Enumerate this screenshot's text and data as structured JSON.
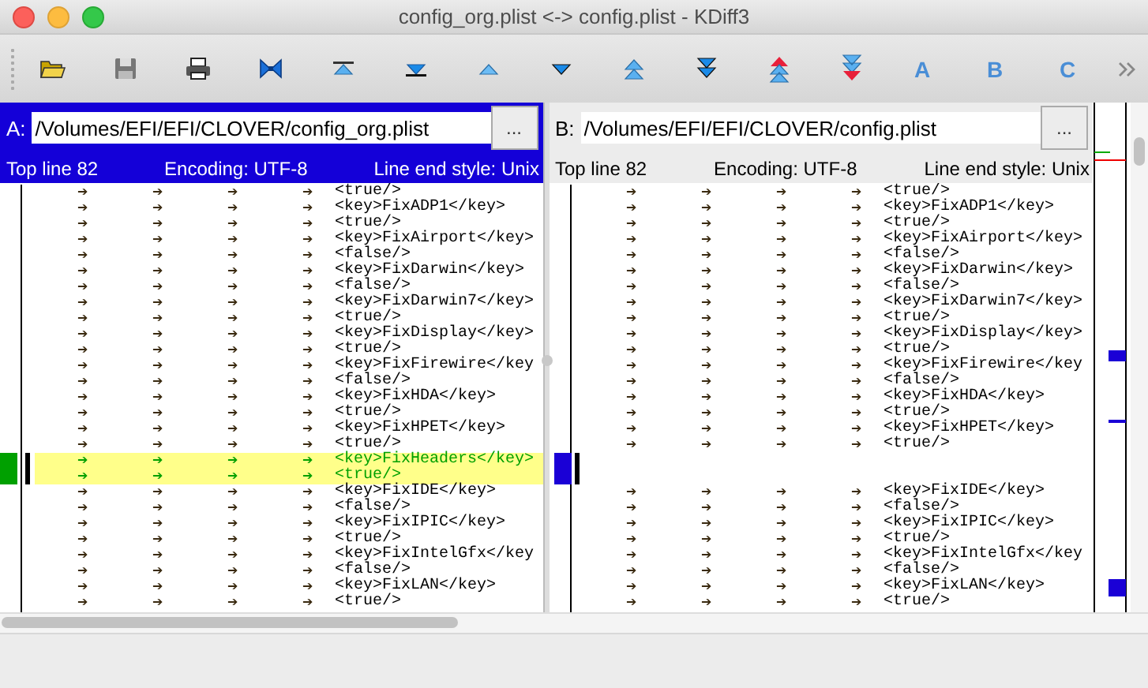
{
  "window": {
    "title": "config_org.plist <-> config.plist - KDiff3"
  },
  "toolbar": {
    "letter_buttons": [
      "A",
      "B",
      "C"
    ]
  },
  "panes": [
    {
      "label": "A:",
      "path": "/Volumes/EFI/EFI/CLOVER/config_org.plist",
      "browse_button": "...",
      "selected": true,
      "top_line": "Top line 82",
      "encoding": "Encoding: UTF-8",
      "line_end": "Line end style: Unix",
      "lines": [
        {
          "kind": "normal",
          "tab_marks": [
            "➔",
            "➔",
            "➔",
            "➔"
          ],
          "text": "<true/>"
        },
        {
          "kind": "normal",
          "tab_marks": [
            "➔",
            "➔",
            "➔",
            "➔"
          ],
          "text": "<key>FixADP1</key>"
        },
        {
          "kind": "normal",
          "tab_marks": [
            "➔",
            "➔",
            "➔",
            "➔"
          ],
          "text": "<true/>"
        },
        {
          "kind": "normal",
          "tab_marks": [
            "➔",
            "➔",
            "➔",
            "➔"
          ],
          "text": "<key>FixAirport</key>"
        },
        {
          "kind": "normal",
          "tab_marks": [
            "➔",
            "➔",
            "➔",
            "➔"
          ],
          "text": "<false/>"
        },
        {
          "kind": "normal",
          "tab_marks": [
            "➔",
            "➔",
            "➔",
            "➔"
          ],
          "text": "<key>FixDarwin</key>"
        },
        {
          "kind": "normal",
          "tab_marks": [
            "➔",
            "➔",
            "➔",
            "➔"
          ],
          "text": "<false/>"
        },
        {
          "kind": "normal",
          "tab_marks": [
            "➔",
            "➔",
            "➔",
            "➔"
          ],
          "text": "<key>FixDarwin7</key>"
        },
        {
          "kind": "normal",
          "tab_marks": [
            "➔",
            "➔",
            "➔",
            "➔"
          ],
          "text": "<true/>"
        },
        {
          "kind": "normal",
          "tab_marks": [
            "➔",
            "➔",
            "➔",
            "➔"
          ],
          "text": "<key>FixDisplay</key>"
        },
        {
          "kind": "normal",
          "tab_marks": [
            "➔",
            "➔",
            "➔",
            "➔"
          ],
          "text": "<true/>"
        },
        {
          "kind": "normal",
          "tab_marks": [
            "➔",
            "➔",
            "➔",
            "➔"
          ],
          "text": "<key>FixFirewire</key"
        },
        {
          "kind": "normal",
          "tab_marks": [
            "➔",
            "➔",
            "➔",
            "➔"
          ],
          "text": "<false/>"
        },
        {
          "kind": "normal",
          "tab_marks": [
            "➔",
            "➔",
            "➔",
            "➔"
          ],
          "text": "<key>FixHDA</key>"
        },
        {
          "kind": "normal",
          "tab_marks": [
            "➔",
            "➔",
            "➔",
            "➔"
          ],
          "text": "<true/>"
        },
        {
          "kind": "normal",
          "tab_marks": [
            "➔",
            "➔",
            "➔",
            "➔"
          ],
          "text": "<key>FixHPET</key>"
        },
        {
          "kind": "normal",
          "tab_marks": [
            "➔",
            "➔",
            "➔",
            "➔"
          ],
          "text": "<true/>"
        },
        {
          "kind": "changed",
          "tab_marks": [
            "➔",
            "➔",
            "➔",
            "➔"
          ],
          "text": "<key>FixHeaders</key>"
        },
        {
          "kind": "changed",
          "tab_marks": [
            "➔",
            "➔",
            "➔",
            "➔"
          ],
          "text": "<true/>"
        },
        {
          "kind": "normal",
          "tab_marks": [
            "➔",
            "➔",
            "➔",
            "➔"
          ],
          "text": "<key>FixIDE</key>"
        },
        {
          "kind": "normal",
          "tab_marks": [
            "➔",
            "➔",
            "➔",
            "➔"
          ],
          "text": "<false/>"
        },
        {
          "kind": "normal",
          "tab_marks": [
            "➔",
            "➔",
            "➔",
            "➔"
          ],
          "text": "<key>FixIPIC</key>"
        },
        {
          "kind": "normal",
          "tab_marks": [
            "➔",
            "➔",
            "➔",
            "➔"
          ],
          "text": "<true/>"
        },
        {
          "kind": "normal",
          "tab_marks": [
            "➔",
            "➔",
            "➔",
            "➔"
          ],
          "text": "<key>FixIntelGfx</key"
        },
        {
          "kind": "normal",
          "tab_marks": [
            "➔",
            "➔",
            "➔",
            "➔"
          ],
          "text": "<false/>"
        },
        {
          "kind": "normal",
          "tab_marks": [
            "➔",
            "➔",
            "➔",
            "➔"
          ],
          "text": "<key>FixLAN</key>"
        },
        {
          "kind": "normal",
          "tab_marks": [
            "➔",
            "➔",
            "➔",
            "➔"
          ],
          "text": "<true/>"
        }
      ]
    },
    {
      "label": "B:",
      "path": "/Volumes/EFI/EFI/CLOVER/config.plist",
      "browse_button": "...",
      "selected": false,
      "top_line": "Top line 82",
      "encoding": "Encoding: UTF-8",
      "line_end": "Line end style: Unix",
      "lines": [
        {
          "kind": "normal",
          "tab_marks": [
            "➔",
            "➔",
            "➔",
            "➔"
          ],
          "text": "<true/>"
        },
        {
          "kind": "normal",
          "tab_marks": [
            "➔",
            "➔",
            "➔",
            "➔"
          ],
          "text": "<key>FixADP1</key>"
        },
        {
          "kind": "normal",
          "tab_marks": [
            "➔",
            "➔",
            "➔",
            "➔"
          ],
          "text": "<true/>"
        },
        {
          "kind": "normal",
          "tab_marks": [
            "➔",
            "➔",
            "➔",
            "➔"
          ],
          "text": "<key>FixAirport</key>"
        },
        {
          "kind": "normal",
          "tab_marks": [
            "➔",
            "➔",
            "➔",
            "➔"
          ],
          "text": "<false/>"
        },
        {
          "kind": "normal",
          "tab_marks": [
            "➔",
            "➔",
            "➔",
            "➔"
          ],
          "text": "<key>FixDarwin</key>"
        },
        {
          "kind": "normal",
          "tab_marks": [
            "➔",
            "➔",
            "➔",
            "➔"
          ],
          "text": "<false/>"
        },
        {
          "kind": "normal",
          "tab_marks": [
            "➔",
            "➔",
            "➔",
            "➔"
          ],
          "text": "<key>FixDarwin7</key>"
        },
        {
          "kind": "normal",
          "tab_marks": [
            "➔",
            "➔",
            "➔",
            "➔"
          ],
          "text": "<true/>"
        },
        {
          "kind": "normal",
          "tab_marks": [
            "➔",
            "➔",
            "➔",
            "➔"
          ],
          "text": "<key>FixDisplay</key>"
        },
        {
          "kind": "normal",
          "tab_marks": [
            "➔",
            "➔",
            "➔",
            "➔"
          ],
          "text": "<true/>"
        },
        {
          "kind": "normal",
          "tab_marks": [
            "➔",
            "➔",
            "➔",
            "➔"
          ],
          "text": "<key>FixFirewire</key"
        },
        {
          "kind": "normal",
          "tab_marks": [
            "➔",
            "➔",
            "➔",
            "➔"
          ],
          "text": "<false/>"
        },
        {
          "kind": "normal",
          "tab_marks": [
            "➔",
            "➔",
            "➔",
            "➔"
          ],
          "text": "<key>FixHDA</key>"
        },
        {
          "kind": "normal",
          "tab_marks": [
            "➔",
            "➔",
            "➔",
            "➔"
          ],
          "text": "<true/>"
        },
        {
          "kind": "normal",
          "tab_marks": [
            "➔",
            "➔",
            "➔",
            "➔"
          ],
          "text": "<key>FixHPET</key>"
        },
        {
          "kind": "normal",
          "tab_marks": [
            "➔",
            "➔",
            "➔",
            "➔"
          ],
          "text": "<true/>"
        },
        {
          "kind": "gap"
        },
        {
          "kind": "gap"
        },
        {
          "kind": "normal",
          "tab_marks": [
            "➔",
            "➔",
            "➔",
            "➔"
          ],
          "text": "<key>FixIDE</key>"
        },
        {
          "kind": "normal",
          "tab_marks": [
            "➔",
            "➔",
            "➔",
            "➔"
          ],
          "text": "<false/>"
        },
        {
          "kind": "normal",
          "tab_marks": [
            "➔",
            "➔",
            "➔",
            "➔"
          ],
          "text": "<key>FixIPIC</key>"
        },
        {
          "kind": "normal",
          "tab_marks": [
            "➔",
            "➔",
            "➔",
            "➔"
          ],
          "text": "<true/>"
        },
        {
          "kind": "normal",
          "tab_marks": [
            "➔",
            "➔",
            "➔",
            "➔"
          ],
          "text": "<key>FixIntelGfx</key"
        },
        {
          "kind": "normal",
          "tab_marks": [
            "➔",
            "➔",
            "➔",
            "➔"
          ],
          "text": "<false/>"
        },
        {
          "kind": "normal",
          "tab_marks": [
            "➔",
            "➔",
            "➔",
            "➔"
          ],
          "text": "<key>FixLAN</key>"
        },
        {
          "kind": "normal",
          "tab_marks": [
            "➔",
            "➔",
            "➔",
            "➔"
          ],
          "text": "<true/>"
        }
      ]
    }
  ]
}
